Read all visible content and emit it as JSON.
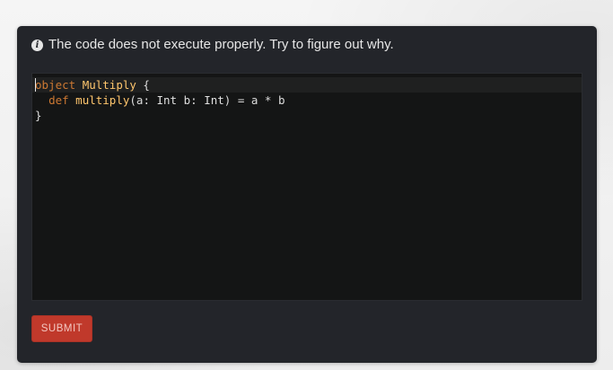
{
  "question": {
    "icon": "info-icon",
    "text": "The code does not execute properly. Try to figure out why."
  },
  "editor": {
    "lines": [
      {
        "tokens": [
          {
            "text": "object",
            "kind": "keyword"
          },
          {
            "text": " ",
            "kind": "plain"
          },
          {
            "text": "Multiply",
            "kind": "def-name"
          },
          {
            "text": " {",
            "kind": "plain"
          }
        ]
      },
      {
        "tokens": [
          {
            "text": "  ",
            "kind": "plain"
          },
          {
            "text": "def",
            "kind": "keyword"
          },
          {
            "text": " ",
            "kind": "plain"
          },
          {
            "text": "multiply",
            "kind": "def-name"
          },
          {
            "text": "(a: ",
            "kind": "plain"
          },
          {
            "text": "Int",
            "kind": "type-name"
          },
          {
            "text": " b: ",
            "kind": "plain"
          },
          {
            "text": "Int",
            "kind": "type-name"
          },
          {
            "text": ") = a * b",
            "kind": "plain"
          }
        ]
      },
      {
        "tokens": [
          {
            "text": "}",
            "kind": "plain"
          }
        ]
      }
    ],
    "colors": {
      "keyword": "#cc7832",
      "def_name": "#ffc66d",
      "background": "#141515"
    }
  },
  "actions": {
    "submit_label": "SUBMIT",
    "submit_color": "#c0392b"
  }
}
